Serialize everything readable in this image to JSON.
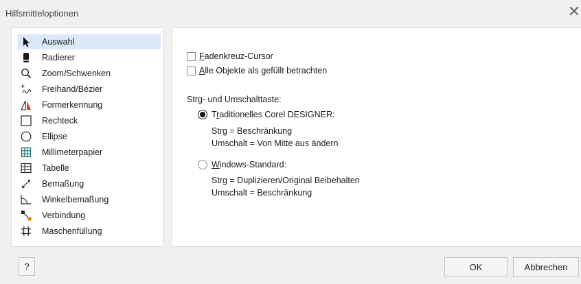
{
  "window": {
    "title": "Hilfsmitteloptionen",
    "close_symbol": "✕"
  },
  "tools": [
    {
      "label": "Auswahl",
      "icon": "pointer-arrow-icon",
      "selected": true
    },
    {
      "label": "Radierer",
      "icon": "eraser-icon"
    },
    {
      "label": "Zoom/Schwenken",
      "icon": "magnifier-icon"
    },
    {
      "label": "Freihand/Bézier",
      "icon": "freehand-icon"
    },
    {
      "label": "Formerkennung",
      "icon": "shape-recognition-icon"
    },
    {
      "label": "Rechteck",
      "icon": "rectangle-icon"
    },
    {
      "label": "Ellipse",
      "icon": "ellipse-icon"
    },
    {
      "label": "Millimeterpapier",
      "icon": "graph-paper-icon"
    },
    {
      "label": "Tabelle",
      "icon": "table-icon"
    },
    {
      "label": "Bemaßung",
      "icon": "dimension-icon"
    },
    {
      "label": "Winkelbemaßung",
      "icon": "angular-dimension-icon"
    },
    {
      "label": "Verbindung",
      "icon": "connector-icon"
    },
    {
      "label": "Maschenfüllung",
      "icon": "mesh-fill-icon"
    }
  ],
  "options": {
    "crosshair": {
      "accel": "F",
      "rest": "adenkreuz-Cursor",
      "checked": false
    },
    "treat_filled": {
      "accel": "A",
      "rest": "lle Objekte als gefüllt betrachten",
      "checked": false
    },
    "modifier_heading": "Strg- und Umschalttaste:",
    "traditional": {
      "prefix": "T",
      "accel": "r",
      "rest": "aditionelles Corel DESIGNER:",
      "checked": true,
      "desc_line1": "Strg = Beschränkung",
      "desc_line2": "Umschalt = Von Mitte aus ändern"
    },
    "windows": {
      "accel": "W",
      "rest": "indows-Standard:",
      "checked": false,
      "desc_line1": "Strg = Duplizieren/Original Beibehalten",
      "desc_line2": "Umschalt = Beschränkung"
    }
  },
  "buttons": {
    "help": "?",
    "ok": "OK",
    "cancel": "Abbrechen"
  },
  "colors": {
    "selection": "#dbe9f8",
    "background": "#f0f0f0",
    "panel": "#ffffff"
  }
}
